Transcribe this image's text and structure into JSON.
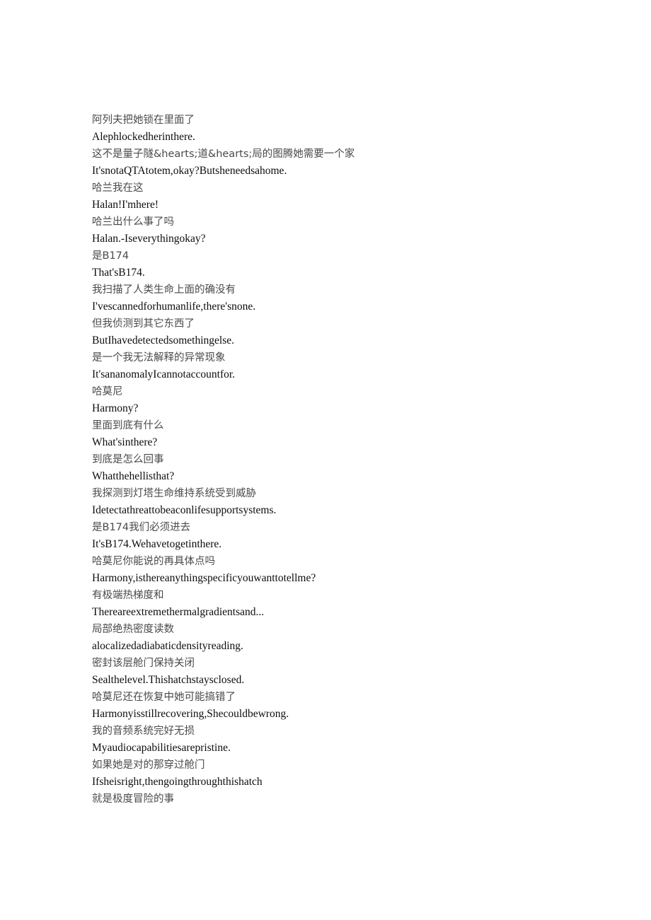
{
  "document": {
    "background_color": "#ffffff",
    "text_color_zh": "#4a4a4a",
    "text_color_en": "#0d0d0d",
    "lines": [
      {
        "lang": "zh",
        "text": "阿列夫把她锁在里面了"
      },
      {
        "lang": "en",
        "text": "Alephlockedherinthere."
      },
      {
        "lang": "zh",
        "text": "这不是量子隧&hearts;道&hearts;局的图腾她需要一个家"
      },
      {
        "lang": "en",
        "text": "It'snotaQTAtotem,okay?Butsheneedsahome."
      },
      {
        "lang": "zh",
        "text": "哈兰我在这"
      },
      {
        "lang": "en",
        "text": "Halan!I'mhere!"
      },
      {
        "lang": "zh",
        "text": "哈兰出什么事了吗"
      },
      {
        "lang": "en",
        "text": "Halan.-Iseverythingokay?"
      },
      {
        "lang": "zh",
        "text": "是B174"
      },
      {
        "lang": "en",
        "text": "That'sB174."
      },
      {
        "lang": "zh",
        "text": "我扫描了人类生命上面的确没有"
      },
      {
        "lang": "en",
        "text": "I'vescannedforhumanlife,there'snone."
      },
      {
        "lang": "zh",
        "text": "但我侦测到其它东西了"
      },
      {
        "lang": "en",
        "text": "ButIhavedetectedsomethingelse."
      },
      {
        "lang": "zh",
        "text": "是一个我无法解释的异常现象"
      },
      {
        "lang": "en",
        "text": "It'sananomalyIcannotaccountfor."
      },
      {
        "lang": "zh",
        "text": "哈莫尼"
      },
      {
        "lang": "en",
        "text": "Harmony?"
      },
      {
        "lang": "zh",
        "text": "里面到底有什么"
      },
      {
        "lang": "en",
        "text": "What'sinthere?"
      },
      {
        "lang": "zh",
        "text": "到底是怎么回事"
      },
      {
        "lang": "en",
        "text": "Whatthehellisthat?"
      },
      {
        "lang": "zh",
        "text": "我探测到灯塔生命维持系统受到威胁"
      },
      {
        "lang": "en",
        "text": "Idetectathreattobeaconlifesupportsystems."
      },
      {
        "lang": "zh",
        "text": "是B174我们必须进去"
      },
      {
        "lang": "en",
        "text": "It'sB174.Wehavetogetinthere."
      },
      {
        "lang": "zh",
        "text": "哈莫尼你能说的再具体点吗"
      },
      {
        "lang": "en",
        "text": "Harmony,isthereanythingspecificyouwanttotellme?"
      },
      {
        "lang": "zh",
        "text": "有极端热梯度和"
      },
      {
        "lang": "en",
        "text": "Thereareextremethermalgradientsand..."
      },
      {
        "lang": "zh",
        "text": "局部绝热密度读数"
      },
      {
        "lang": "en",
        "text": "alocalizedadiabaticdensityreading."
      },
      {
        "lang": "zh",
        "text": "密封该层舱门保持关闭"
      },
      {
        "lang": "en",
        "text": "Sealthelevel.Thishatchstaysclosed."
      },
      {
        "lang": "zh",
        "text": "哈莫尼还在恢复中她可能搞错了"
      },
      {
        "lang": "en",
        "text": "Harmonyisstillrecovering,Shecouldbewrong."
      },
      {
        "lang": "zh",
        "text": "我的音频系统完好无损"
      },
      {
        "lang": "en",
        "text": "Myaudiocapabilitiesarepristine."
      },
      {
        "lang": "zh",
        "text": "如果她是对的那穿过舱门"
      },
      {
        "lang": "en",
        "text": "Ifsheisright,thengoingthroughthishatch"
      },
      {
        "lang": "zh",
        "text": "就是极度冒险的事"
      }
    ]
  }
}
